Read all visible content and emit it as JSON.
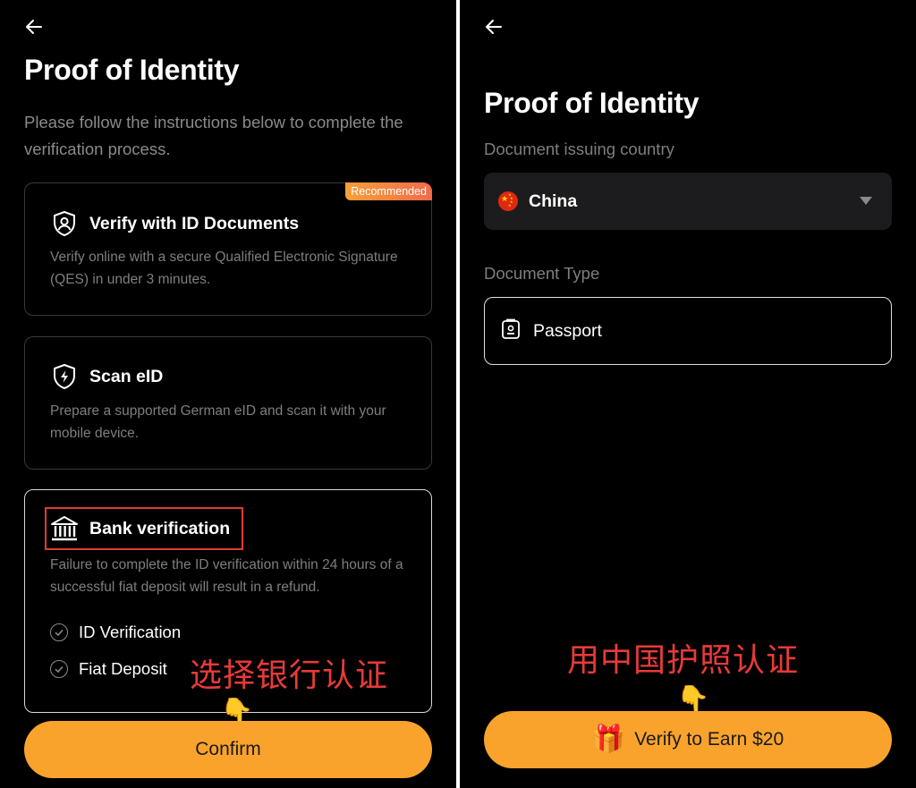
{
  "left": {
    "title": "Proof of Identity",
    "subtitle": "Please follow the instructions below to complete the verification process.",
    "cards": [
      {
        "title": "Verify with ID Documents",
        "icon": "user-shield-icon",
        "badge": "Recommended",
        "desc": "Verify online with a secure Qualified Electronic Signature (QES) in under 3 minutes."
      },
      {
        "title": "Scan eID",
        "icon": "shield-bolt-icon",
        "desc": "Prepare a supported German eID and scan it with your mobile device."
      },
      {
        "title": "Bank verification",
        "icon": "bank-icon",
        "desc": "Failure to complete the ID verification within 24 hours of a successful fiat deposit will result in a refund.",
        "steps": [
          "ID Verification",
          "Fiat Deposit"
        ]
      }
    ],
    "annotation": "选择银行认证",
    "pointer": "👇",
    "confirm_label": "Confirm"
  },
  "right": {
    "title": "Proof of Identity",
    "country_label": "Document issuing country",
    "country_value": "China",
    "doc_type_label": "Document Type",
    "doc_type_option": "Passport",
    "annotation": "用中国护照认证",
    "pointer": "👇",
    "cta_icon": "🎁",
    "cta_label": "Verify to Earn $20"
  },
  "colors": {
    "background": "#000000",
    "accent": "#f9a32d",
    "annotation": "#e83a3a",
    "muted_text": "#7e7e7e"
  }
}
